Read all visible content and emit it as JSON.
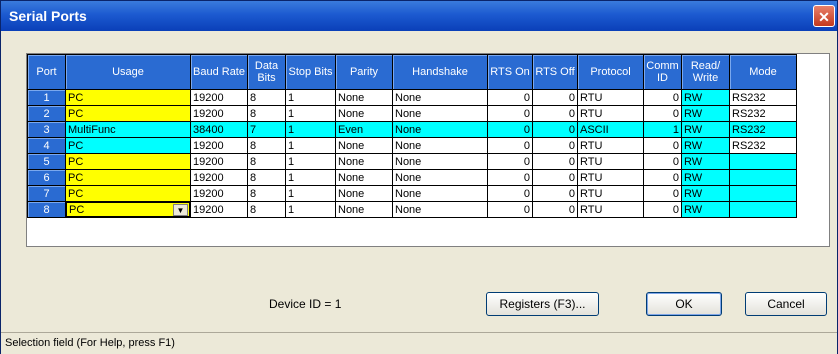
{
  "window": {
    "title": "Serial Ports",
    "close_glyph": "✕"
  },
  "columns": {
    "port": "Port",
    "usage": "Usage",
    "baud": "Baud Rate",
    "data": "Data Bits",
    "stop": "Stop Bits",
    "parity": "Parity",
    "handshake": "Handshake",
    "rts_on": "RTS On",
    "rts_off": "RTS Off",
    "protocol": "Protocol",
    "comm_id": "Comm ID",
    "rw": "Read/ Write",
    "mode": "Mode"
  },
  "rows": [
    {
      "port": "1",
      "usage": "PC",
      "baud": "19200",
      "data": "8",
      "stop": "1",
      "parity": "None",
      "handshake": "None",
      "rts_on": "0",
      "rts_off": "0",
      "protocol": "RTU",
      "comm_id": "0",
      "rw": "RW",
      "mode": "RS232"
    },
    {
      "port": "2",
      "usage": "PC",
      "baud": "19200",
      "data": "8",
      "stop": "1",
      "parity": "None",
      "handshake": "None",
      "rts_on": "0",
      "rts_off": "0",
      "protocol": "RTU",
      "comm_id": "0",
      "rw": "RW",
      "mode": "RS232"
    },
    {
      "port": "3",
      "usage": "MultiFunc",
      "baud": "38400",
      "data": "7",
      "stop": "1",
      "parity": "Even",
      "handshake": "None",
      "rts_on": "0",
      "rts_off": "0",
      "protocol": "ASCII",
      "comm_id": "1",
      "rw": "RW",
      "mode": "RS232"
    },
    {
      "port": "4",
      "usage": "PC",
      "baud": "19200",
      "data": "8",
      "stop": "1",
      "parity": "None",
      "handshake": "None",
      "rts_on": "0",
      "rts_off": "0",
      "protocol": "RTU",
      "comm_id": "0",
      "rw": "RW",
      "mode": "RS232"
    },
    {
      "port": "5",
      "usage": "PC",
      "baud": "19200",
      "data": "8",
      "stop": "1",
      "parity": "None",
      "handshake": "None",
      "rts_on": "0",
      "rts_off": "0",
      "protocol": "RTU",
      "comm_id": "0",
      "rw": "RW",
      "mode": ""
    },
    {
      "port": "6",
      "usage": "PC",
      "baud": "19200",
      "data": "8",
      "stop": "1",
      "parity": "None",
      "handshake": "None",
      "rts_on": "0",
      "rts_off": "0",
      "protocol": "RTU",
      "comm_id": "0",
      "rw": "RW",
      "mode": ""
    },
    {
      "port": "7",
      "usage": "PC",
      "baud": "19200",
      "data": "8",
      "stop": "1",
      "parity": "None",
      "handshake": "None",
      "rts_on": "0",
      "rts_off": "0",
      "protocol": "RTU",
      "comm_id": "0",
      "rw": "RW",
      "mode": ""
    },
    {
      "port": "8",
      "usage": "PC",
      "baud": "19200",
      "data": "8",
      "stop": "1",
      "parity": "None",
      "handshake": "None",
      "rts_on": "0",
      "rts_off": "0",
      "protocol": "RTU",
      "comm_id": "0",
      "rw": "RW",
      "mode": ""
    }
  ],
  "device_id": "Device ID = 1",
  "buttons": {
    "registers": "Registers (F3)...",
    "ok": "OK",
    "cancel": "Cancel"
  },
  "status": "Selection field (For Help, press F1)",
  "colors": {
    "header_blue": "#2a6bd2",
    "yellow": "#ffff00",
    "cyan": "#00ffff"
  }
}
